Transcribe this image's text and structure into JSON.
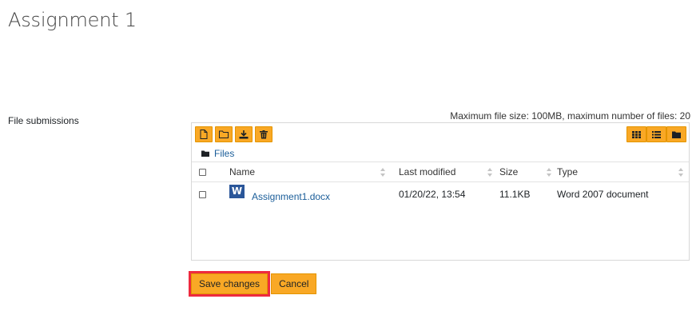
{
  "page": {
    "title": "Assignment 1"
  },
  "form": {
    "field_label": "File submissions",
    "limits_text": "Maximum file size: 100MB, maximum number of files: 20"
  },
  "filemanager": {
    "toolbar_left": [
      "add-file-icon",
      "create-folder-icon",
      "download-icon",
      "delete-icon"
    ],
    "toolbar_right": [
      "grid-view-icon",
      "list-view-icon",
      "tree-view-icon"
    ],
    "breadcrumb": {
      "label": "Files"
    },
    "columns": {
      "name": "Name",
      "modified": "Last modified",
      "size": "Size",
      "type": "Type"
    },
    "files": [
      {
        "name": "Assignment1.docx",
        "modified": "01/20/22, 13:54",
        "size": "11.1KB",
        "type": "Word 2007 document",
        "icon": "word-document-icon",
        "icon_letter": "W"
      }
    ]
  },
  "buttons": {
    "save": "Save changes",
    "cancel": "Cancel"
  },
  "colors": {
    "accent": "#f9a825",
    "link": "#1a5d99",
    "highlight": "#ee2a3f",
    "word_blue": "#2a5699"
  }
}
